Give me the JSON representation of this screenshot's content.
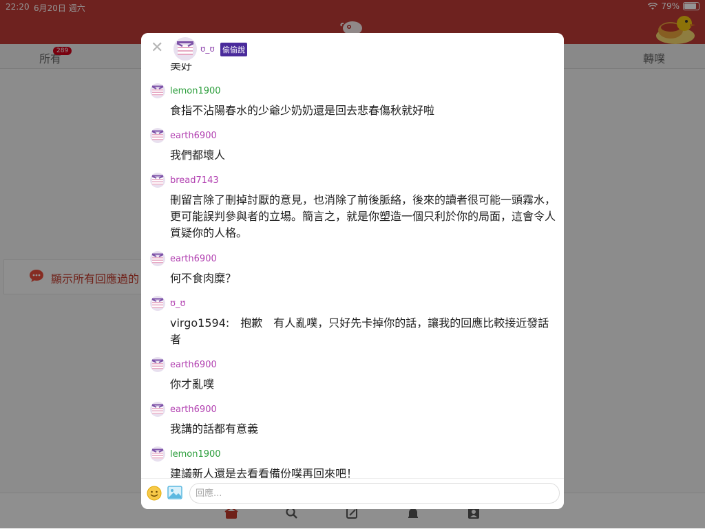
{
  "status_bar": {
    "time": "22:20",
    "date": "6月20日 週六",
    "battery": "79%"
  },
  "colors": {
    "header_red": "#bd3b36",
    "badge_purple": "#4a2b9b",
    "user_green": "#2a9d3a",
    "user_purple": "#b13fb0"
  },
  "background": {
    "tabs": {
      "all_label": "所有",
      "all_count": "289",
      "replurk_label": "轉噗"
    },
    "show_all_text": "顯示所有回應過的"
  },
  "modal": {
    "author_name": "ʊ_ʊ",
    "author_badge": "偷偷說",
    "partial_text": "美好",
    "replies": [
      {
        "user": "lemon1900",
        "user_color": "green",
        "text": "食指不沾陽春水的少爺少奶奶還是回去悲春傷秋就好啦"
      },
      {
        "user": "earth6900",
        "user_color": "purple",
        "text": "我們都壞人"
      },
      {
        "user": "bread7143",
        "user_color": "purple",
        "text": "刪留言除了刪掉討厭的意見，也消除了前後脈絡，後來的讀者很可能一頭霧水，更可能誤判參與者的立場。簡言之，就是你塑造一個只利於你的局面，這會令人質疑你的人格。"
      },
      {
        "user": "earth6900",
        "user_color": "purple",
        "text": "何不食肉糜？"
      },
      {
        "user": "ʊ_ʊ",
        "user_color": "purple",
        "text": "virgo1594:　抱歉　有人亂噗，只好先卡掉你的話，讓我的回應比較接近發話者"
      },
      {
        "user": "earth6900",
        "user_color": "purple",
        "text": "你才亂噗"
      },
      {
        "user": "earth6900",
        "user_color": "purple",
        "text": "我講的話都有意義"
      },
      {
        "user": "lemon1900",
        "user_color": "green",
        "text": "建議新人還是去看看備份噗再回來吧！"
      }
    ],
    "composer": {
      "placeholder": "回應..."
    }
  }
}
